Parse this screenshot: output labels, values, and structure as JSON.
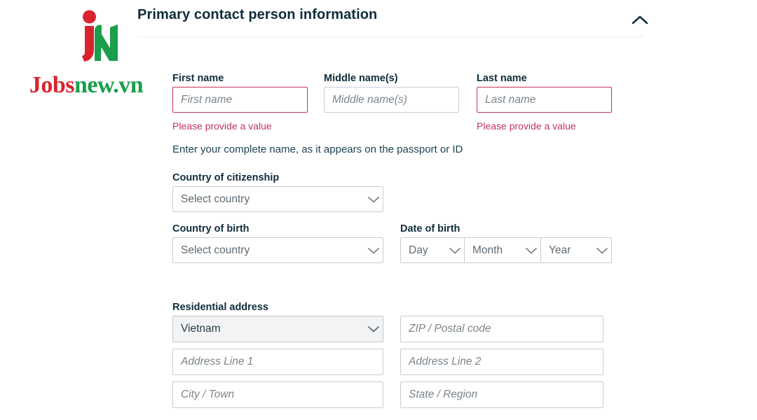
{
  "brand": {
    "mark_icon": "jn-monogram-icon",
    "word_part1": "Jobs",
    "word_part2": "new.vn",
    "color_red": "#d8242e",
    "color_green": "#1a9e4b"
  },
  "panel": {
    "title": "Primary contact person information",
    "collapse_icon": "chevron-up-icon"
  },
  "colors": {
    "heading": "#0f2d3b",
    "error": "#c2335f",
    "border": "#c9cdd1",
    "filled_bg": "#f2f3f4"
  },
  "name_section": {
    "first_name": {
      "label": "First name",
      "placeholder": "First name",
      "value": "",
      "error": "Please provide a value"
    },
    "middle_name": {
      "label": "Middle name(s)",
      "placeholder": "Middle name(s)",
      "value": ""
    },
    "last_name": {
      "label": "Last name",
      "placeholder": "Last name",
      "value": "",
      "error": "Please provide a value"
    },
    "help": "Enter your complete name, as it appears on the passport or ID"
  },
  "citizenship": {
    "label": "Country of citizenship",
    "value": "Select country",
    "caret_icon": "chevron-down-icon"
  },
  "country_of_birth": {
    "label": "Country of birth",
    "value": "Select country",
    "caret_icon": "chevron-down-icon"
  },
  "date_of_birth": {
    "label": "Date of birth",
    "day": "Day",
    "month": "Month",
    "year": "Year",
    "caret_icon": "chevron-down-icon"
  },
  "residential_address": {
    "label": "Residential address",
    "country": "Vietnam",
    "zip_placeholder": "ZIP / Postal code",
    "zip_value": "",
    "address1_placeholder": "Address Line 1",
    "address1_value": "",
    "address2_placeholder": "Address Line 2",
    "address2_value": "",
    "city_placeholder": "City / Town",
    "city_value": "",
    "state_placeholder": "State / Region",
    "state_value": "",
    "caret_icon": "chevron-down-icon"
  }
}
